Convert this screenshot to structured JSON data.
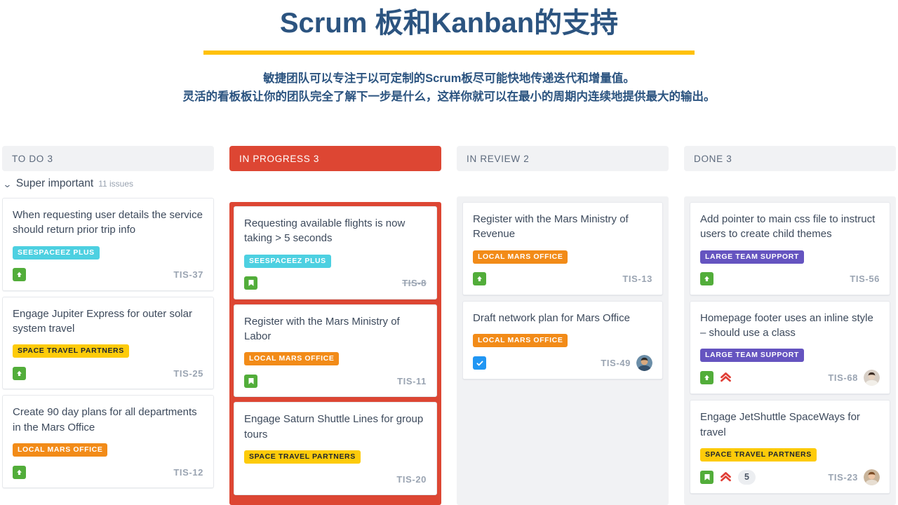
{
  "header": {
    "title": "Scrum 板和Kanban的支持",
    "subtitle_line1": "敏捷团队可以专注于以可定制的Scrum板尽可能快地传递迭代和增量值。",
    "subtitle_line2": "灵活的看板板让你的团队完全了解下一步是什么，这样你就可以在最小的周期内连续地提供最大的输出。",
    "rule_color": "#FFC107",
    "title_color": "#2c5480"
  },
  "board": {
    "swimlane": {
      "name": "Super important",
      "count_label": "11 issues",
      "chevron_icon": "chevron-down-icon"
    },
    "columns": [
      {
        "id": "todo",
        "header": "TO DO 3",
        "active": false,
        "cards": [
          {
            "title": "When requesting user details the service should return prior trip info",
            "label": {
              "text": "SEESPACEEZ PLUS",
              "bg": "#4dd0e1",
              "fg": "#ffffff"
            },
            "type_icon": "priority-up-icon",
            "key": "TIS-37",
            "key_strike": false,
            "priority_icon": "",
            "count": "",
            "avatar": ""
          },
          {
            "title": "Engage Jupiter Express for outer solar system travel",
            "label": {
              "text": "SPACE TRAVEL PARTNERS",
              "bg": "#fdcb0a",
              "fg": "#1d2430"
            },
            "type_icon": "priority-up-icon",
            "key": "TIS-25",
            "key_strike": false,
            "priority_icon": "",
            "count": "",
            "avatar": ""
          },
          {
            "title": "Create 90 day plans for all departments in the Mars Office",
            "label": {
              "text": "LOCAL MARS OFFICE",
              "bg": "#f28b18",
              "fg": "#ffffff"
            },
            "type_icon": "priority-up-icon",
            "key": "TIS-12",
            "key_strike": false,
            "priority_icon": "",
            "count": "",
            "avatar": ""
          }
        ]
      },
      {
        "id": "inprogress",
        "header": "IN PROGRESS  3",
        "active": true,
        "active_color": "#dd4633",
        "cards": [
          {
            "title": "Requesting available flights is now taking > 5 seconds",
            "label": {
              "text": "SEESPACEEZ PLUS",
              "bg": "#4dd0e1",
              "fg": "#ffffff"
            },
            "type_icon": "story-bookmark-icon",
            "key": "TIS-8",
            "key_strike": true,
            "priority_icon": "",
            "count": "",
            "avatar": ""
          },
          {
            "title": "Register with the Mars Ministry of Labor",
            "label": {
              "text": "LOCAL MARS OFFICE",
              "bg": "#f28b18",
              "fg": "#ffffff"
            },
            "type_icon": "story-bookmark-icon",
            "key": "TIS-11",
            "key_strike": false,
            "priority_icon": "",
            "count": "",
            "avatar": ""
          },
          {
            "title": "Engage Saturn Shuttle Lines for group tours",
            "label": {
              "text": "SPACE TRAVEL PARTNERS",
              "bg": "#fdcb0a",
              "fg": "#1d2430"
            },
            "type_icon": "",
            "key": "TIS-20",
            "key_strike": false,
            "priority_icon": "",
            "count": "",
            "avatar": ""
          }
        ]
      },
      {
        "id": "inreview",
        "header": "IN REVIEW 2",
        "active": false,
        "cards": [
          {
            "title": "Register with the Mars Ministry of Revenue",
            "label": {
              "text": "LOCAL MARS OFFICE",
              "bg": "#f28b18",
              "fg": "#ffffff"
            },
            "type_icon": "priority-up-icon",
            "key": "TIS-13",
            "key_strike": false,
            "priority_icon": "",
            "count": "",
            "avatar": ""
          },
          {
            "title": "Draft network plan for Mars Office",
            "label": {
              "text": "LOCAL MARS OFFICE",
              "bg": "#f28b18",
              "fg": "#ffffff"
            },
            "type_icon": "task-check-icon",
            "key": "TIS-49",
            "key_strike": false,
            "priority_icon": "",
            "count": "",
            "avatar": "avatar-dark"
          }
        ]
      },
      {
        "id": "done",
        "header": "DONE 3",
        "active": false,
        "cards": [
          {
            "title": "Add pointer to main css file to instruct users to create child themes",
            "label": {
              "text": "LARGE TEAM SUPPORT",
              "bg": "#6554c0",
              "fg": "#ffffff"
            },
            "type_icon": "priority-up-icon",
            "key": "TIS-56",
            "key_strike": false,
            "priority_icon": "",
            "count": "",
            "avatar": ""
          },
          {
            "title": "Homepage footer uses an inline style – should use a class",
            "label": {
              "text": "LARGE TEAM SUPPORT",
              "bg": "#6554c0",
              "fg": "#ffffff"
            },
            "type_icon": "priority-up-icon",
            "key": "TIS-68",
            "key_strike": false,
            "priority_icon": "priority-highest-icon",
            "count": "",
            "avatar": "avatar-light"
          },
          {
            "title": "Engage JetShuttle SpaceWays for travel",
            "label": {
              "text": "SPACE TRAVEL PARTNERS",
              "bg": "#fdcb0a",
              "fg": "#1d2430"
            },
            "type_icon": "story-bookmark-icon",
            "key": "TIS-23",
            "key_strike": false,
            "priority_icon": "priority-highest-icon",
            "count": "5",
            "avatar": "avatar-woman"
          }
        ]
      }
    ]
  }
}
